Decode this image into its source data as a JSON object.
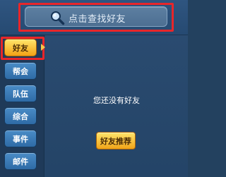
{
  "search": {
    "placeholder": "点击查找好友",
    "icon": "magnifier-icon"
  },
  "sidebar": {
    "items": [
      {
        "label": "好友",
        "active": true
      },
      {
        "label": "帮会",
        "active": false
      },
      {
        "label": "队伍",
        "active": false
      },
      {
        "label": "综合",
        "active": false
      },
      {
        "label": "事件",
        "active": false
      },
      {
        "label": "邮件",
        "active": false
      }
    ]
  },
  "main": {
    "empty_message": "您还没有好友",
    "recommend_label": "好友推荐"
  },
  "colors": {
    "highlight": "#e8262a",
    "active_tab": "#f2a216",
    "panel": "#27466a"
  }
}
